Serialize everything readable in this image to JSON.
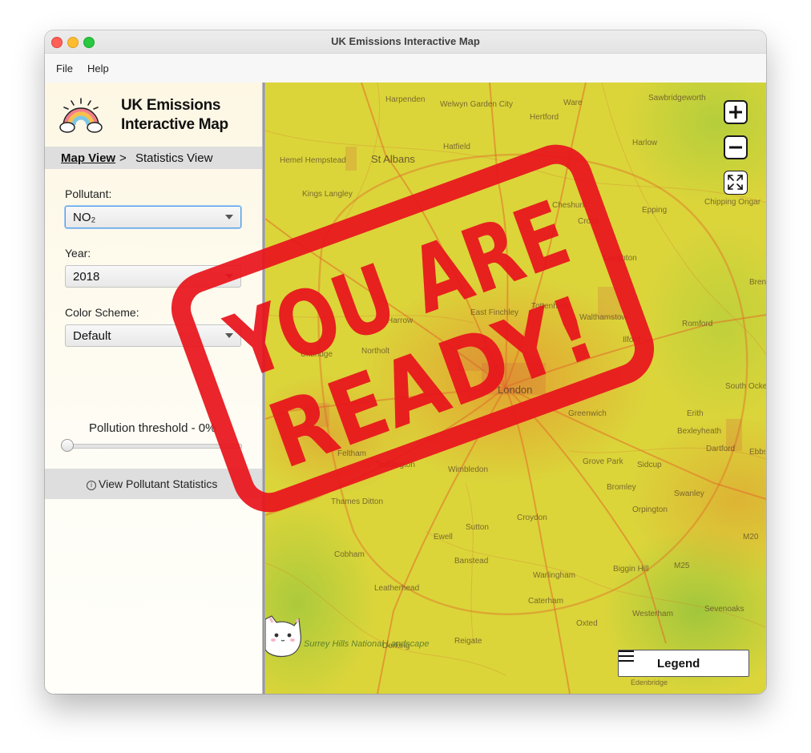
{
  "window": {
    "title": "UK Emissions Interactive Map"
  },
  "menu": {
    "file": "File",
    "help": "Help"
  },
  "sidebar": {
    "logo_icon": "rainbow-icon",
    "app_name_line1": "UK Emissions",
    "app_name_line2": "Interactive Map",
    "nav": {
      "map_view": "Map View",
      "separator": ">",
      "statistics_view": "Statistics View"
    },
    "pollutant": {
      "label": "Pollutant:",
      "value": "NO₂"
    },
    "year": {
      "label": "Year:",
      "value": "2018"
    },
    "color_scheme": {
      "label": "Color Scheme:",
      "value": "Default"
    },
    "threshold": {
      "label": "Pollution threshold - 0%",
      "value_percent": 0
    },
    "stats_button": {
      "icon": "info-icon",
      "label": "View Pollutant Statistics"
    }
  },
  "map": {
    "places": [
      "Harpenden",
      "Welwyn Garden City",
      "Ware",
      "Sawbridgeworth",
      "Hertford",
      "Hatfield",
      "Harlow",
      "Hemel Hempstead",
      "St Albans",
      "Kings Langley",
      "Cheshunt",
      "Epping",
      "Chipping Ongar",
      "Cross",
      "Loughton",
      "Brentwood",
      "East Finchley",
      "Tottenham",
      "Walthamstow",
      "Romford",
      "Harrow",
      "Northolt",
      "Uxbridge",
      "Ilford",
      "Greenwich",
      "London",
      "South Ockendon",
      "Erith",
      "Bexleyheath",
      "Dartford",
      "Ebbsfleet Valley",
      "Feltham",
      "Teddington",
      "Wimbledon",
      "Thames Ditton",
      "Grove Park",
      "Sidcup",
      "Bromley",
      "Swanley",
      "Orpington",
      "Croydon",
      "Sutton",
      "Ewell",
      "Cobham",
      "Banstead",
      "Warlingham",
      "Biggin Hill",
      "Leatherhead",
      "Caterham",
      "Oxted",
      "Westerham",
      "Sevenoaks",
      "Reigate",
      "Dorking",
      "Surrey Hills National Landscape",
      "M25",
      "M20",
      "Edenbridge"
    ],
    "zoom_in_icon": "plus-icon",
    "zoom_out_icon": "minus-icon",
    "fullscreen_icon": "expand-icon",
    "legend": {
      "icon": "menu-icon",
      "label": "Legend"
    },
    "mascot_icon": "cat-icon"
  },
  "overlay": {
    "stamp_line1": "YOU ARE",
    "stamp_line2": "READY!",
    "stamp_color": "#e8141c"
  }
}
